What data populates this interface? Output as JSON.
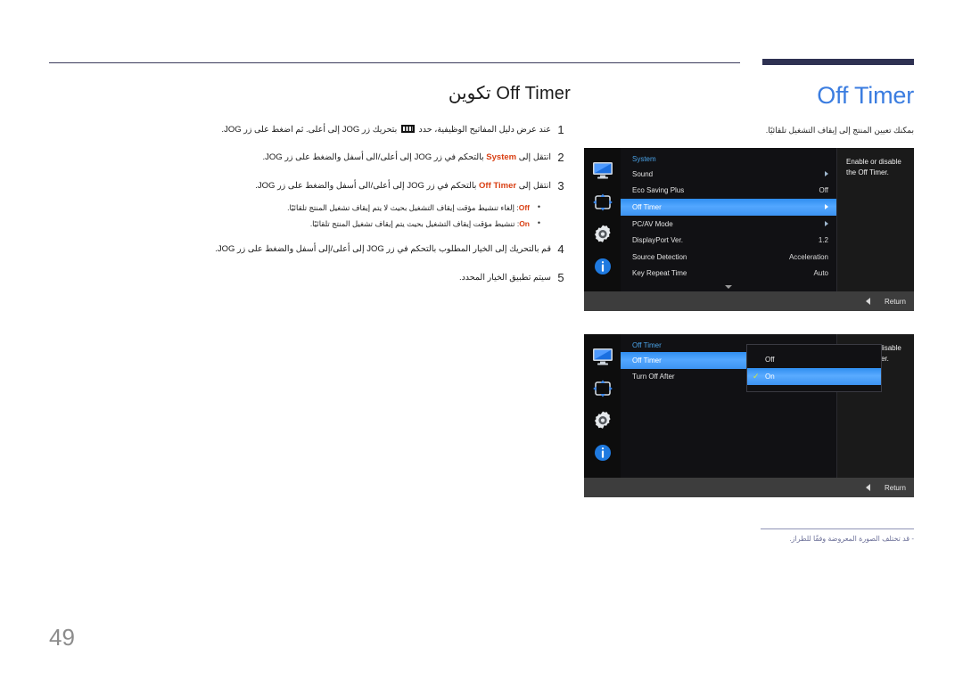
{
  "page": {
    "number": "49",
    "accent_blue": "#3b7de0",
    "keyword_red": "#d93f13",
    "rule_navy": "#2e3152"
  },
  "left": {
    "title_arabic": "تكوين",
    "title_latin": "Off Timer",
    "steps": [
      {
        "num": "1",
        "before_icon": "عند عرض دليل المفاتيح الوظيفية، حدد ",
        "icon": "function-key-guide-icon",
        "after_icon": " بتحريك زر JOG إلى أعلى. ثم اضغط على زر JOG."
      },
      {
        "num": "2",
        "prefix": "انتقل إلى ",
        "keyword": "System",
        "suffix": " بالتحكم في زر JOG إلى أعلى/الى أسفل والضغط على زر JOG."
      },
      {
        "num": "3",
        "prefix": "انتقل إلى ",
        "keyword": "Off Timer",
        "suffix": " بالتحكم في زر JOG إلى أعلى/الى أسفل والضغط على زر JOG."
      }
    ],
    "bullets": [
      {
        "keyword": "Off",
        "text": ": إلغاء تنشيط مؤقت إيقاف التشغيل بحيث لا يتم إيقاف تشغيل المنتج تلقائيًا."
      },
      {
        "keyword": "On",
        "text": ": تنشيط مؤقت إيقاف التشغيل بحيث يتم إيقاف تشغيل المنتج تلقائيًا."
      }
    ],
    "steps_after": [
      {
        "num": "4",
        "text": "قم بالتحريك إلى الخيار المطلوب بالتحكم في زر JOG إلى أعلى/إلى أسفل والضغط على زر JOG."
      },
      {
        "num": "5",
        "text": "سيتم تطبيق الخيار المحدد."
      }
    ]
  },
  "right": {
    "title": "Off Timer",
    "description": "بمكنك تعيين المنتج إلى إيقاف التشغيل تلقائيًا.",
    "footnote": "‑ قد تختلف الصورة المعروضة وفقًا للطراز."
  },
  "osd_sidebar_icons": [
    "monitor-icon",
    "picture-position-icon",
    "gear-icon",
    "info-icon"
  ],
  "osd_top": {
    "menu_title": "System",
    "rows": [
      {
        "label": "Sound",
        "value": "",
        "arrow": true,
        "selected": false
      },
      {
        "label": "Eco Saving Plus",
        "value": "Off",
        "arrow": false,
        "selected": false
      },
      {
        "label": "Off Timer",
        "value": "",
        "arrow": true,
        "selected": true
      },
      {
        "label": "PC/AV Mode",
        "value": "",
        "arrow": true,
        "selected": false
      },
      {
        "label": "DisplayPort Ver.",
        "value": "1.2",
        "arrow": false,
        "selected": false
      },
      {
        "label": "Source Detection",
        "value": "Acceleration",
        "arrow": false,
        "selected": false
      },
      {
        "label": "Key Repeat Time",
        "value": "Auto",
        "arrow": false,
        "selected": false
      }
    ],
    "help": "Enable or disable the Off Timer.",
    "footer_label": "Return"
  },
  "osd_bottom": {
    "menu_title": "Off Timer",
    "rows": [
      {
        "label": "Off Timer",
        "value": "",
        "arrow": false,
        "selected": true
      },
      {
        "label": "Turn Off After",
        "value": "",
        "arrow": false,
        "selected": false
      }
    ],
    "dropdown": [
      {
        "label": "Off",
        "checked": false,
        "selected": false
      },
      {
        "label": "On",
        "checked": true,
        "selected": true
      }
    ],
    "check_glyph": "✓",
    "help": "Enable or disable the Off Timer.",
    "footer_label": "Return"
  }
}
